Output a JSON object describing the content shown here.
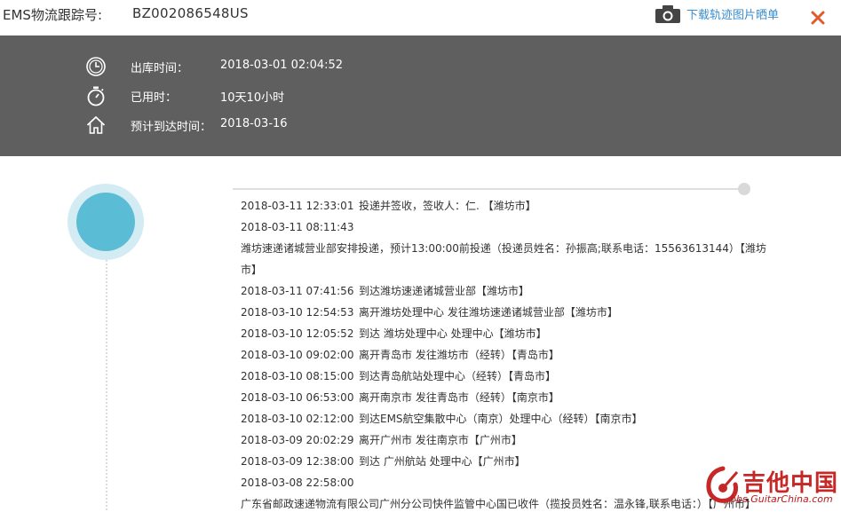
{
  "header": {
    "tracking_label": "EMS物流跟踪号:",
    "tracking_number": "BZ002086548US",
    "download_link": "下载轨迹图片晒单",
    "camera_icon": "camera-icon",
    "close_icon": "close-icon",
    "close_color": "#e05a2b"
  },
  "summary": {
    "rows": [
      {
        "icon": "clock-icon",
        "label": "出库时间：",
        "value": "2018-03-01 02:04:52"
      },
      {
        "icon": "stopwatch-icon",
        "label": "已用时：",
        "value": "10天10小时"
      },
      {
        "icon": "home-icon",
        "label": "预计到达时间：",
        "value": "2018-03-16"
      }
    ],
    "background": "#5f5f5f"
  },
  "timeline": {
    "accent": "#5bbdd5",
    "events": [
      {
        "time": "2018-03-11 12:33:01",
        "text": "投递并签收，签收人：仁.         【潍坊市】"
      },
      {
        "time": "2018-03-11 08:11:43",
        "text": ""
      },
      {
        "time": "",
        "text": "潍坊速递诸城营业部安排投递，预计13:00:00前投递（投递员姓名：孙振高;联系电话：15563613144）【潍坊市】"
      },
      {
        "time": "2018-03-11 07:41:56",
        "text": "到达潍坊速递诸城营业部【潍坊市】"
      },
      {
        "time": "2018-03-10 12:54:53",
        "text": "离开潍坊处理中心 发往潍坊速递诸城营业部【潍坊市】"
      },
      {
        "time": "2018-03-10 12:05:52",
        "text": "到达 潍坊处理中心 处理中心【潍坊市】"
      },
      {
        "time": "2018-03-10 09:02:00",
        "text": "离开青岛市 发往潍坊市（经转）【青岛市】"
      },
      {
        "time": "2018-03-10 08:15:00",
        "text": "到达青岛航站处理中心（经转）【青岛市】"
      },
      {
        "time": "2018-03-10 06:53:00",
        "text": "离开南京市 发往青岛市（经转）【南京市】"
      },
      {
        "time": "2018-03-10 02:12:00",
        "text": "到达EMS航空集散中心（南京）处理中心（经转）【南京市】"
      },
      {
        "time": "2018-03-09 20:02:29",
        "text": "离开广州市 发往南京市【广州市】"
      },
      {
        "time": "2018-03-09 12:38:00",
        "text": "到达 广州航站 处理中心【广州市】"
      },
      {
        "time": "2018-03-08 22:58:00",
        "text": ""
      },
      {
        "time": "",
        "text": "广东省邮政速递物流有限公司广州分公司快件监管中心国已收件（揽投员姓名：温永锋,联系电话：）【广州市】"
      }
    ]
  },
  "watermark": {
    "text": "吉他中国",
    "url": "bbs.GuitarChina.com",
    "color": "#c62828"
  }
}
